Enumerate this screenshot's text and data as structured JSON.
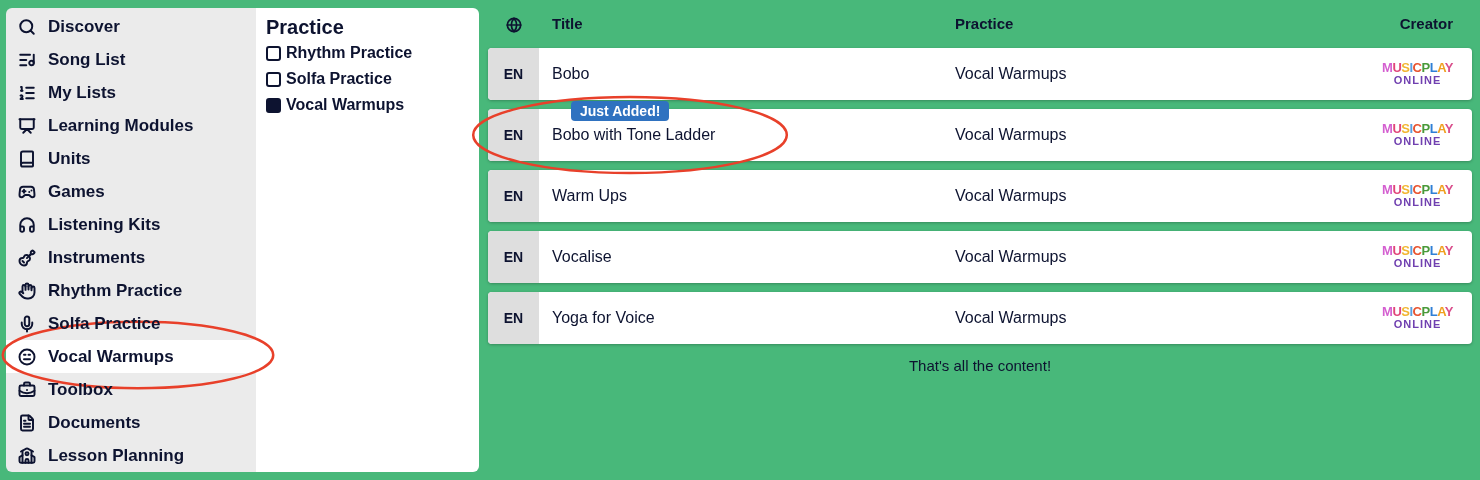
{
  "sidebar": {
    "items": [
      {
        "label": "Discover",
        "selected": false,
        "circled": false
      },
      {
        "label": "Song List",
        "selected": false,
        "circled": false
      },
      {
        "label": "My Lists",
        "selected": false,
        "circled": false
      },
      {
        "label": "Learning Modules",
        "selected": false,
        "circled": false
      },
      {
        "label": "Units",
        "selected": false,
        "circled": false
      },
      {
        "label": "Games",
        "selected": false,
        "circled": false
      },
      {
        "label": "Listening Kits",
        "selected": false,
        "circled": false
      },
      {
        "label": "Instruments",
        "selected": false,
        "circled": false
      },
      {
        "label": "Rhythm Practice",
        "selected": false,
        "circled": false
      },
      {
        "label": "Solfa Practice",
        "selected": false,
        "circled": false
      },
      {
        "label": "Vocal Warmups",
        "selected": true,
        "circled": true
      },
      {
        "label": "Toolbox",
        "selected": false,
        "circled": false
      },
      {
        "label": "Documents",
        "selected": false,
        "circled": false
      },
      {
        "label": "Lesson Planning",
        "selected": false,
        "circled": false
      }
    ]
  },
  "filter": {
    "title": "Practice",
    "options": [
      {
        "label": "Rhythm Practice",
        "checked": false
      },
      {
        "label": "Solfa Practice",
        "checked": false
      },
      {
        "label": "Vocal Warmups",
        "checked": true
      }
    ]
  },
  "table": {
    "columns": [
      "Title",
      "Practice",
      "Creator"
    ],
    "rows": [
      {
        "language": "EN",
        "title": "Bobo",
        "practice": "Vocal Warmups",
        "creator": [
          "MUSICPLAY",
          "ONLINE"
        ],
        "circled": false
      },
      {
        "language": "EN",
        "title": "Bobo with Tone Ladder",
        "badge": "Just Added!",
        "practice": "Vocal Warmups",
        "creator": [
          "MUSICPLAY",
          "ONLINE"
        ],
        "circled": true
      },
      {
        "language": "EN",
        "title": "Warm Ups",
        "practice": "Vocal Warmups",
        "creator": [
          "MUSICPLAY",
          "ONLINE"
        ],
        "circled": false
      },
      {
        "language": "EN",
        "title": "Vocalise",
        "practice": "Vocal Warmups",
        "creator": [
          "MUSICPLAY",
          "ONLINE"
        ],
        "circled": false
      },
      {
        "language": "EN",
        "title": "Yoga for Voice",
        "practice": "Vocal Warmups",
        "creator": [
          "MUSICPLAY",
          "ONLINE"
        ],
        "circled": false
      }
    ],
    "footer": "That's all the content!"
  }
}
